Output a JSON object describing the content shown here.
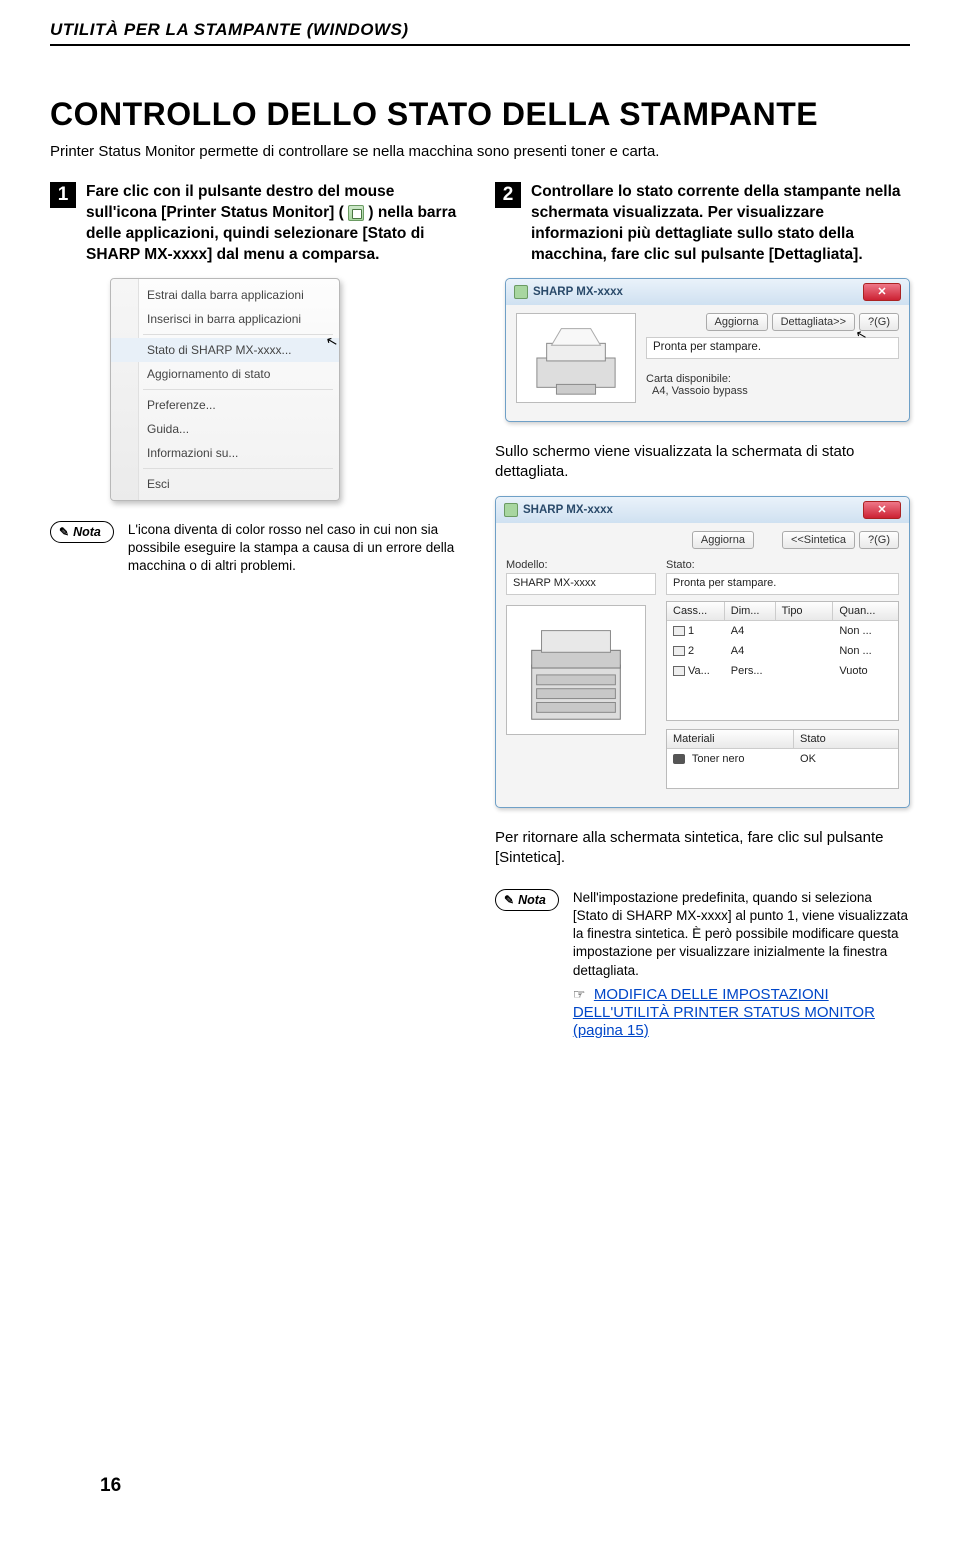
{
  "header": "UTILITÀ PER LA STAMPANTE (WINDOWS)",
  "title": "CONTROLLO DELLO STATO DELLA STAMPANTE",
  "intro": "Printer Status Monitor permette di controllare se nella macchina sono presenti toner e carta.",
  "step1_pre": "Fare clic con il pulsante destro del mouse sull'icona [Printer Status Monitor] (",
  "step1_post": ") nella barra delle applicazioni, quindi selezionare [Stato di SHARP MX-xxxx] dal menu a comparsa.",
  "ctx": {
    "i1": "Estrai dalla barra applicazioni",
    "i2": "Inserisci in barra applicazioni",
    "i3": "Stato di SHARP MX-xxxx...",
    "i4": "Aggiornamento di stato",
    "i5": "Preferenze...",
    "i6": "Guida...",
    "i7": "Informazioni su...",
    "i8": "Esci"
  },
  "note1_label": "Nota",
  "note1_text": "L'icona diventa di color rosso nel caso in cui non sia possibile eseguire la stampa a causa di un errore della macchina o di altri problemi.",
  "step2": "Controllare lo stato corrente della stampante nella schermata visualizzata. Per visualizzare informazioni più dettagliate sullo stato della macchina, fare clic sul pulsante [Dettagliata].",
  "compact": {
    "title": "SHARP MX-xxxx",
    "btn_refresh": "Aggiorna",
    "btn_detail": "Dettagliata>>",
    "btn_help": "?(G)",
    "status": "Pronta per stampare.",
    "avail_label": "Carta disponibile:",
    "avail_val": "A4, Vassoio bypass"
  },
  "body2": "Sullo schermo viene visualizzata la schermata di stato dettagliata.",
  "detail": {
    "title": "SHARP MX-xxxx",
    "btn_refresh": "Aggiorna",
    "btn_compact": "<<Sintetica",
    "btn_help": "?(G)",
    "model_label": "Modello:",
    "model_val": "SHARP MX-xxxx",
    "state_label": "Stato:",
    "state_val": "Pronta per stampare.",
    "th_cass": "Cass...",
    "th_dim": "Dim...",
    "th_tipo": "Tipo",
    "th_quan": "Quan...",
    "r1_cass": "1",
    "r1_dim": "A4",
    "r1_tipo": "",
    "r1_quan": "Non ...",
    "r2_cass": "2",
    "r2_dim": "A4",
    "r2_tipo": "",
    "r2_quan": "Non ...",
    "r3_cass": "Va...",
    "r3_dim": "Pers...",
    "r3_tipo": "",
    "r3_quan": "Vuoto",
    "th_mat": "Materiali",
    "th_stato": "Stato",
    "m1_name": "Toner nero",
    "m1_state": "OK"
  },
  "body3": "Per ritornare alla schermata sintetica, fare clic sul pulsante [Sintetica].",
  "note2_label": "Nota",
  "note2_text": "Nell'impostazione predefinita, quando si seleziona [Stato di SHARP MX-xxxx] al punto 1, viene visualizzata la finestra sintetica. È però possibile modificare questa impostazione per visualizzare inizialmente la finestra dettagliata.",
  "xref_icon": "☞",
  "link_text": "MODIFICA DELLE IMPOSTAZIONI DELL'UTILITÀ PRINTER STATUS MONITOR (pagina 15)",
  "pagenum": "16"
}
